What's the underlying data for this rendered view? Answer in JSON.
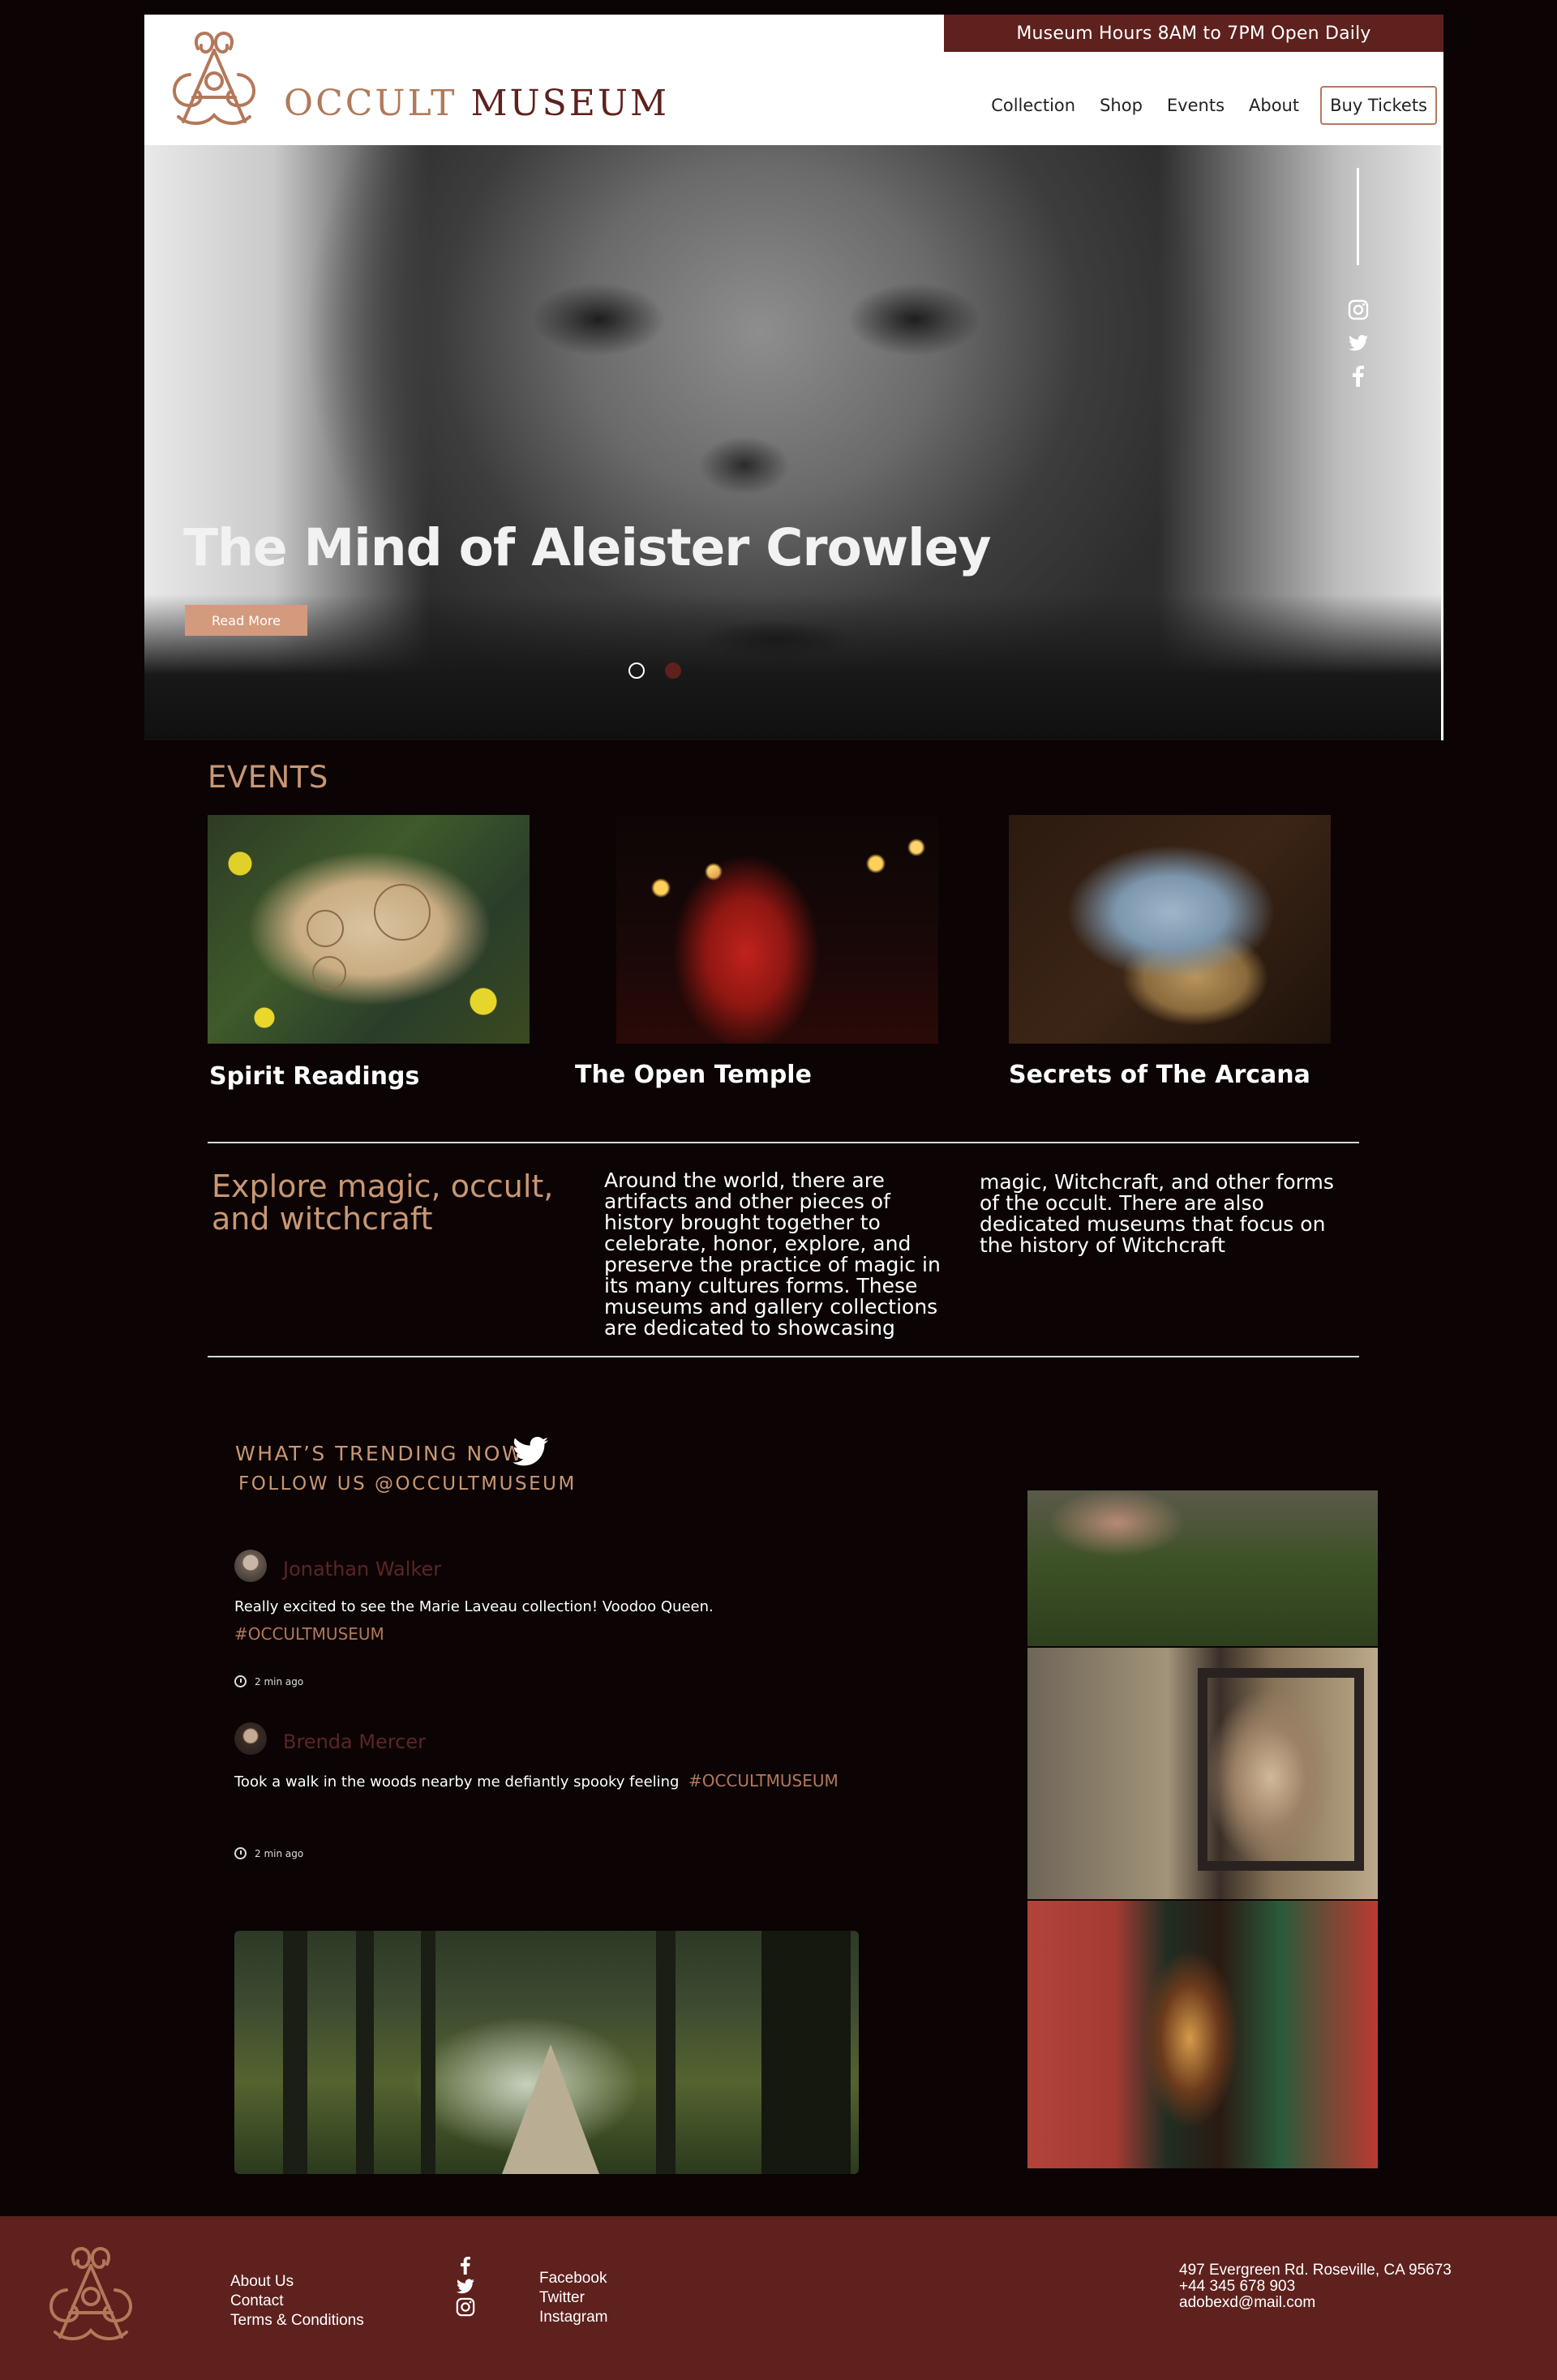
{
  "header": {
    "hours": "Museum  Hours 8AM to 7PM Open Daily",
    "logo_word1": "OCCULT",
    "logo_word2": "MUSEUM",
    "nav": [
      "Collection",
      "Shop",
      "Events",
      "About"
    ],
    "buy_label": "Buy Tickets"
  },
  "hero": {
    "title": "The Mind of Aleister Crowley",
    "button_label": "Read More",
    "slide_count": 2,
    "active_slide": 1,
    "social_icons": [
      "instagram-icon",
      "twitter-icon",
      "facebook-icon"
    ]
  },
  "events": {
    "title": "EVENTS",
    "items": [
      {
        "name": "Spirit Readings"
      },
      {
        "name": "The Open Temple"
      },
      {
        "name": "Secrets of The Arcana"
      }
    ]
  },
  "explore": {
    "heading": "Explore magic, occult, and witchcraft",
    "col1": "Around the world, there are artifacts and other pieces of history brought together to celebrate, honor, explore, and preserve the practice of magic in its many cultures forms. These museums and gallery collections are dedicated to showcasing",
    "col2": "magic, Witchcraft, and other forms of the occult. There are also dedicated museums that focus on the history of Witchcraft"
  },
  "trending": {
    "title": "WHAT’S TRENDING NOW",
    "subtitle": "FOLLOW US @OCCULTMUSEUM",
    "posts": [
      {
        "user": "Jonathan Walker",
        "text": "Really excited to see the Marie Laveau collection! Voodoo Queen.",
        "hashtag": "#OCCULTMUSEUM",
        "time": "2 min ago"
      },
      {
        "user": "Brenda Mercer",
        "text": "Took a walk in the woods nearby me defiantly spooky feeling",
        "hashtag": "#OCCULTMUSEUM",
        "time": "2 min ago"
      }
    ]
  },
  "footer": {
    "links": [
      "About Us",
      "Contact",
      "Terms & Conditions"
    ],
    "social": [
      "Facebook",
      "Twitter",
      "Instagram"
    ],
    "address": [
      "497 Evergreen Rd. Roseville, CA 95673",
      "+44 345 678 903",
      "adobexd@mail.com"
    ]
  },
  "colors": {
    "background": "#0b0304",
    "brand_maroon": "#5e211d",
    "accent_tan": "#c99773",
    "button_tan": "#d49a7e"
  }
}
